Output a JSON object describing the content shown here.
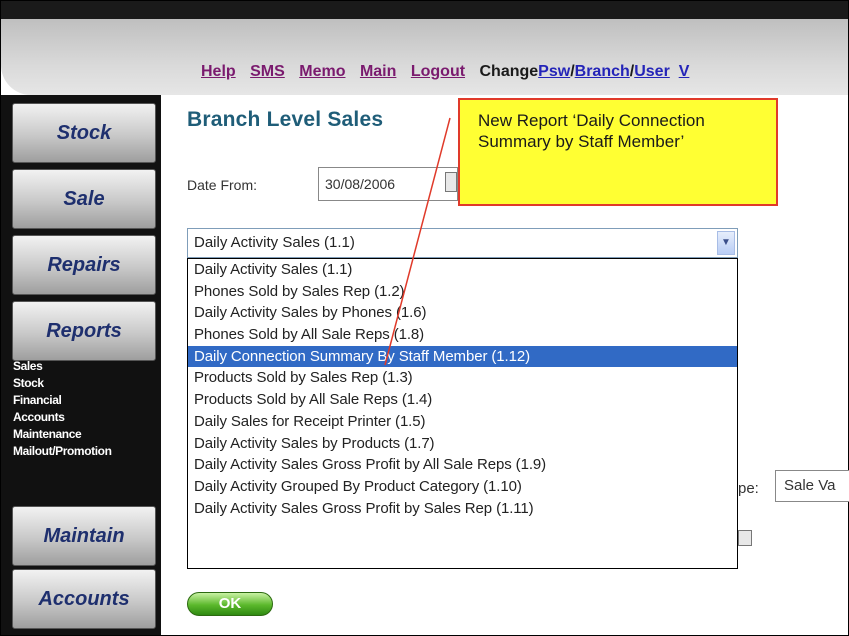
{
  "nav": {
    "links": [
      {
        "label": "Help"
      },
      {
        "label": "SMS"
      },
      {
        "label": "Memo"
      },
      {
        "label": "Main"
      },
      {
        "label": "Logout"
      }
    ],
    "change_prefix": "Change",
    "change_links": [
      "Psw",
      "Branch",
      "User",
      "V"
    ]
  },
  "sidebar": {
    "buttons": [
      "Stock",
      "Sale",
      "Repairs",
      "Reports",
      "Maintain",
      "Accounts"
    ],
    "submenu": [
      "Sales",
      "Stock",
      "Financial",
      "Accounts",
      "Maintenance",
      "Mailout/Promotion"
    ]
  },
  "main": {
    "title": "Branch Level Sales",
    "date_from_label": "Date From:",
    "date_from_value": "30/08/2006",
    "report_select_value": "Daily Activity Sales (1.1)",
    "report_options": [
      "Daily Activity Sales (1.1)",
      "Phones Sold by Sales Rep (1.2)",
      "Daily Activity Sales by Phones (1.6)",
      "Phones Sold by All Sale Reps (1.8)",
      "Daily Connection Summary By Staff Member (1.12)",
      "Products Sold by Sales Rep (1.3)",
      "Products Sold by All Sale Reps (1.4)",
      "Daily Sales for Receipt Printer (1.5)",
      "Daily Activity Sales by Products (1.7)",
      "Daily Activity Sales Gross Profit by All Sale Reps (1.9)",
      "Daily Activity Grouped By Product Category (1.10)",
      "Daily Activity Sales Gross Profit by Sales Rep (1.11)"
    ],
    "selected_option_index": 4,
    "type_label_partial": "pe:",
    "type_select_value": "Sale Va",
    "ok_label": "OK"
  },
  "callout": {
    "text": "New Report ‘Daily Connection Summary by Staff Member’"
  },
  "colors": {
    "title": "#1f5d78",
    "selected_option_bg": "#316ac5",
    "callout_bg": "#ffff33",
    "callout_border": "#e03a2a",
    "link": "#7a1a6e"
  }
}
